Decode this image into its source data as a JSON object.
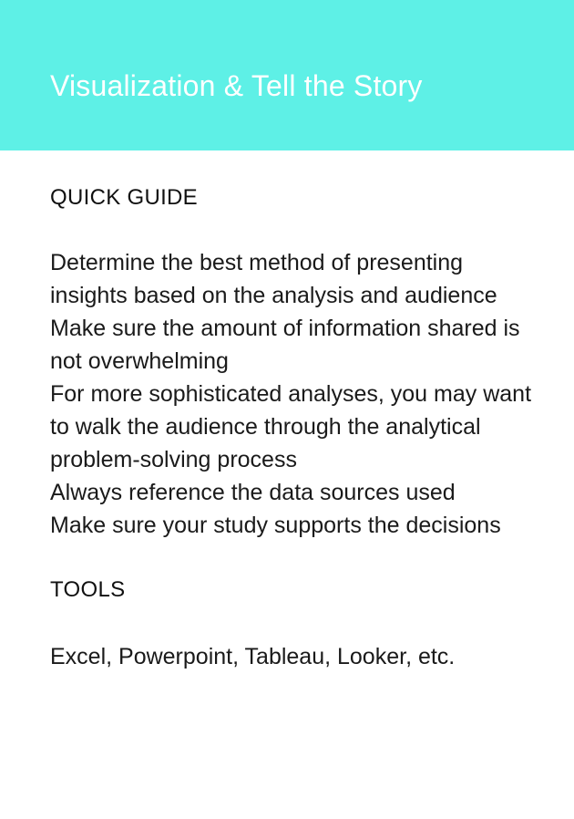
{
  "header": {
    "title": "Visualization & Tell the Story",
    "background_color": "#5ef0e6"
  },
  "quick_guide": {
    "heading": "QUICK GUIDE",
    "items": [
      "Determine the best method of presenting insights based on the analysis and audience",
      "Make sure the amount of information shared is not overwhelming",
      "For more sophisticated analyses, you may want to walk the audience through the analytical problem-solving process",
      "Always reference the data sources used",
      "Make sure your study supports the decisions"
    ]
  },
  "tools": {
    "heading": "TOOLS",
    "text": "Excel, Powerpoint, Tableau, Looker, etc."
  }
}
